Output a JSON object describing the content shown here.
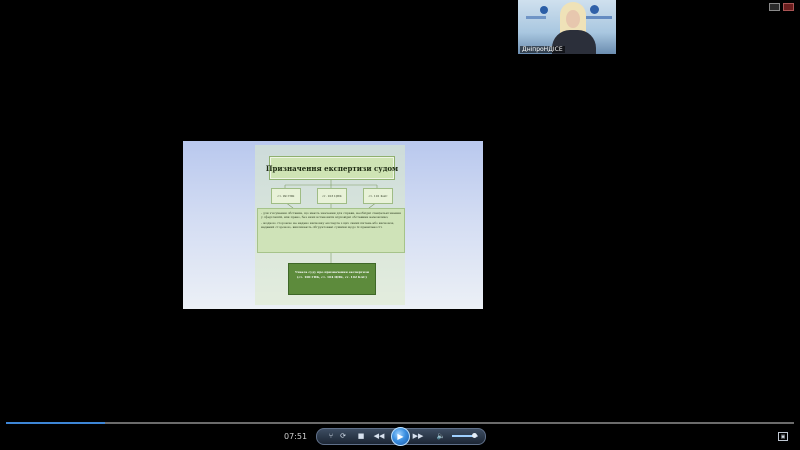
{
  "webcam": {
    "label": "ДніпроНДІСЕ"
  },
  "slide": {
    "title": "Призначення експертизи судом",
    "laws": [
      "ст. 99 ГПК",
      "ст. 103 ЦПК",
      "ст. 101 КАС"
    ],
    "text1": "- для з'ясування обставин, що мають значення для справи, необхідні спеціальні знання у сфері іншій, ніж право, без яких встановити відповідні обставини неможливо;",
    "text2": "- жодною стороною не надано висновку експерта з цих самих питань або висновок, наданий стороною, викликають обґрунтовані сумніви щодо їх правильності.",
    "result_line1": "Ухвала суду про призначення експертизи",
    "result_line2": "(ст. 100 ГПК, ст. 104 ЦПК, ст. 102 КАС)"
  },
  "player": {
    "time": "07:51",
    "progress": 0.125,
    "volume": 0.85,
    "icons": {
      "playlist": "playlist-icon",
      "repeat": "repeat-icon",
      "stop": "stop-icon",
      "rewind": "rewind-icon",
      "play": "play-icon",
      "forward": "fast-forward-icon",
      "volume": "volume-icon",
      "fullscreen": "fullscreen-icon"
    }
  }
}
